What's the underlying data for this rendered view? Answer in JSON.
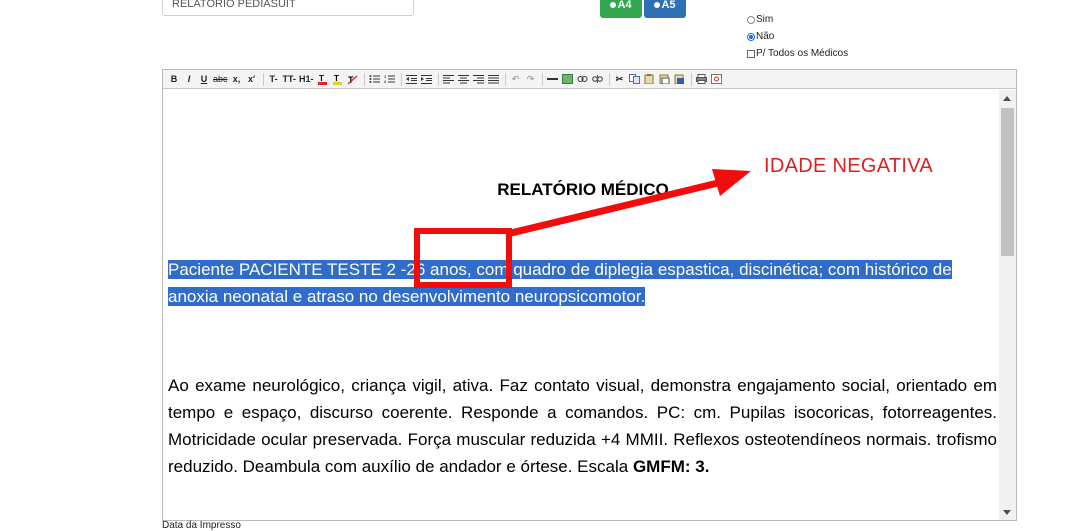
{
  "report_field": {
    "value": "RELATORIO PEDIASUIT"
  },
  "page_size": {
    "a4_label": "A4",
    "a5_label": "A5",
    "selected": "A4"
  },
  "options": {
    "sim_label": "Sim",
    "nao_label": "Não",
    "nao_selected": true,
    "all_doctors_label": "P/ Todos os Médicos"
  },
  "toolbar": {
    "bold": "B",
    "italic": "I",
    "underline": "U",
    "strike": "abc",
    "subscript": "x,",
    "superscript": "x'",
    "font": "T-",
    "font_size": "TT-",
    "heading": "H1-"
  },
  "document": {
    "title": "RELATÓRIO MÉDICO",
    "para1_before": "Paciente PACIENTE TESTE 2 ",
    "para1_age": " -26 anos,",
    "para1_after": " com quadro de diplegia espastica, discinética; com histórico de anoxia neonatal e atraso no desenvolvimento neuropsicomotor.",
    "para2_text": "Ao exame neurológico, criança vigil, ativa. Faz contato visual, demonstra engajamento social, orientado em tempo e espaço, discurso coerente. Responde a comandos. PC: cm. Pupilas isocoricas, fotorreagentes. Motricidade ocular preservada. Força muscular reduzida +4 MMII. Reflexos osteotendíneos normais. trofismo reduzido. Deambula com auxílio de andador e órtese. Escala ",
    "para2_bold": "GMFM: 3."
  },
  "annotation": {
    "label": "IDADE NEGATIVA",
    "color": "#e02020"
  },
  "footer": {
    "print_date_label": "Data da Impresso"
  }
}
